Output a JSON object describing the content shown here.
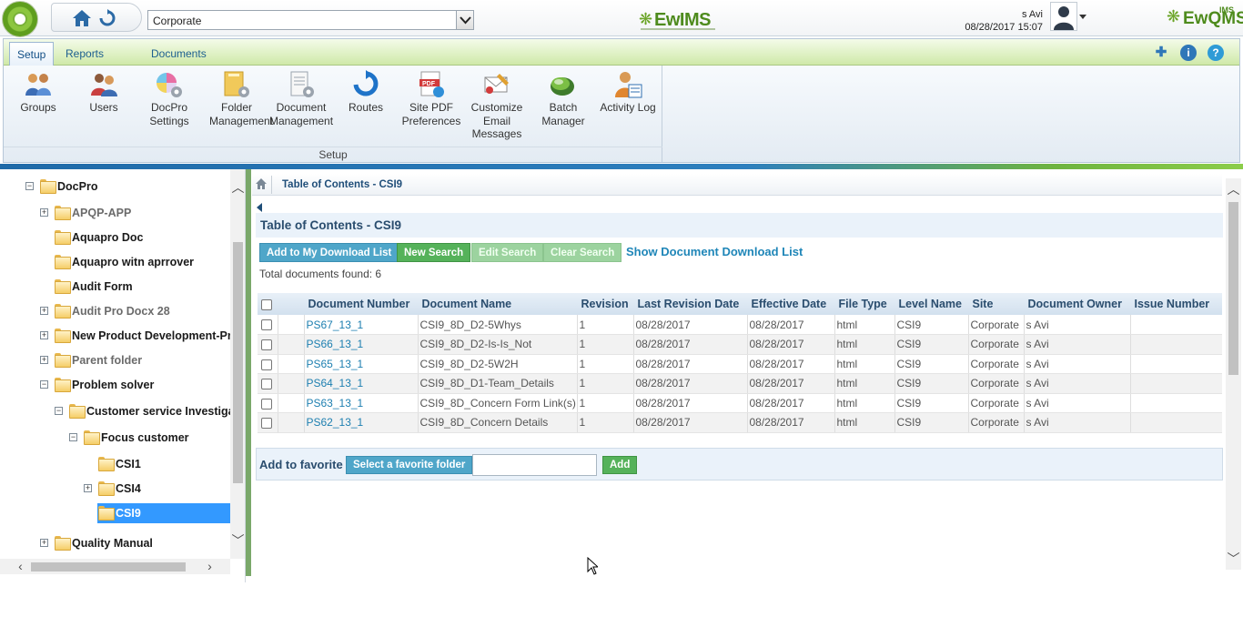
{
  "header": {
    "site_select_value": "Corporate",
    "center_logo_text": "EwIMS",
    "user_name": "s Avi",
    "datetime": "08/28/2017 15:07",
    "right_logo_text": "EwQMS",
    "right_logo_tag": "IMS"
  },
  "ribbon": {
    "tabs": [
      {
        "label": "Setup",
        "active": true
      },
      {
        "label": "Reports",
        "active": false
      },
      {
        "label": "Documents",
        "active": false
      }
    ],
    "items": [
      {
        "label": "Groups",
        "icon": "groups-icon"
      },
      {
        "label": "Users",
        "icon": "users-icon"
      },
      {
        "label": "DocPro Settings",
        "icon": "docpro-settings-icon"
      },
      {
        "label": "Folder Management",
        "icon": "folder-management-icon"
      },
      {
        "label": "Document Management",
        "icon": "document-management-icon"
      },
      {
        "label": "Routes",
        "icon": "routes-icon"
      },
      {
        "label": "Site PDF Preferences",
        "icon": "site-pdf-icon"
      },
      {
        "label": "Customize Email Messages",
        "icon": "email-icon"
      },
      {
        "label": "Batch Manager",
        "icon": "batch-manager-icon"
      },
      {
        "label": "Activity Log",
        "icon": "activity-log-icon"
      }
    ],
    "group_label": "Setup",
    "util_icons": [
      "pin-icon",
      "info-icon",
      "help-icon"
    ]
  },
  "tree": {
    "nodes": [
      {
        "label": "DocPro",
        "toggle": "−"
      },
      {
        "label": "APQP-APP",
        "toggle": "+"
      },
      {
        "label": "Aquapro Doc",
        "toggle": ""
      },
      {
        "label": "Aquapro witn aprrover",
        "toggle": ""
      },
      {
        "label": "Audit Form",
        "toggle": ""
      },
      {
        "label": "Audit Pro Docx 28",
        "toggle": "+"
      },
      {
        "label": "New Product Development-Pro",
        "toggle": "+"
      },
      {
        "label": "Parent folder",
        "toggle": "+"
      },
      {
        "label": "Problem solver",
        "toggle": "−"
      },
      {
        "label": "Customer service Investigati",
        "toggle": "−"
      },
      {
        "label": "Focus customer",
        "toggle": "−"
      },
      {
        "label": "CSI1",
        "toggle": ""
      },
      {
        "label": "CSI4",
        "toggle": "+"
      },
      {
        "label": "CSI9",
        "toggle": "",
        "selected": true
      },
      {
        "label": "Quality Manual",
        "toggle": "+"
      }
    ]
  },
  "breadcrumb": {
    "text": "Table of Contents - CSI9"
  },
  "toc": {
    "title": "Table of Contents - CSI9",
    "btn_add_download": "Add to My Download List",
    "btn_new_search": "New Search",
    "btn_edit_search": "Edit Search",
    "btn_clear_search": "Clear Search",
    "link_show_download": "Show Document Download List",
    "total_found": "Total documents found: 6",
    "columns": [
      "",
      "",
      "Document Number",
      "Document Name",
      "Revision",
      "Last Revision Date",
      "Effective Date",
      "File Type",
      "Level Name",
      "Site",
      "Document Owner",
      "Issue Number"
    ],
    "rows": [
      [
        "PS67_13_1",
        "CSI9_8D_D2-5Whys",
        "1",
        "08/28/2017",
        "08/28/2017",
        "html",
        "CSI9",
        "Corporate",
        "s Avi",
        ""
      ],
      [
        "PS66_13_1",
        "CSI9_8D_D2-Is-Is_Not",
        "1",
        "08/28/2017",
        "08/28/2017",
        "html",
        "CSI9",
        "Corporate",
        "s Avi",
        ""
      ],
      [
        "PS65_13_1",
        "CSI9_8D_D2-5W2H",
        "1",
        "08/28/2017",
        "08/28/2017",
        "html",
        "CSI9",
        "Corporate",
        "s Avi",
        ""
      ],
      [
        "PS64_13_1",
        "CSI9_8D_D1-Team_Details",
        "1",
        "08/28/2017",
        "08/28/2017",
        "html",
        "CSI9",
        "Corporate",
        "s Avi",
        ""
      ],
      [
        "PS63_13_1",
        "CSI9_8D_Concern Form Link(s)",
        "1",
        "08/28/2017",
        "08/28/2017",
        "html",
        "CSI9",
        "Corporate",
        "s Avi",
        ""
      ],
      [
        "PS62_13_1",
        "CSI9_8D_Concern Details",
        "1",
        "08/28/2017",
        "08/28/2017",
        "html",
        "CSI9",
        "Corporate",
        "s Avi",
        ""
      ]
    ]
  },
  "favorite": {
    "label": "Add to favorite",
    "btn_select_folder": "Select a favorite folder",
    "input_value": "",
    "btn_add": "Add"
  },
  "colors": {
    "accent_blue": "#1f86b8",
    "button_green": "#55b25a",
    "button_blue": "#4fa6c9",
    "brand_green": "#4e8b1d",
    "tree_selected": "#3399ff"
  }
}
